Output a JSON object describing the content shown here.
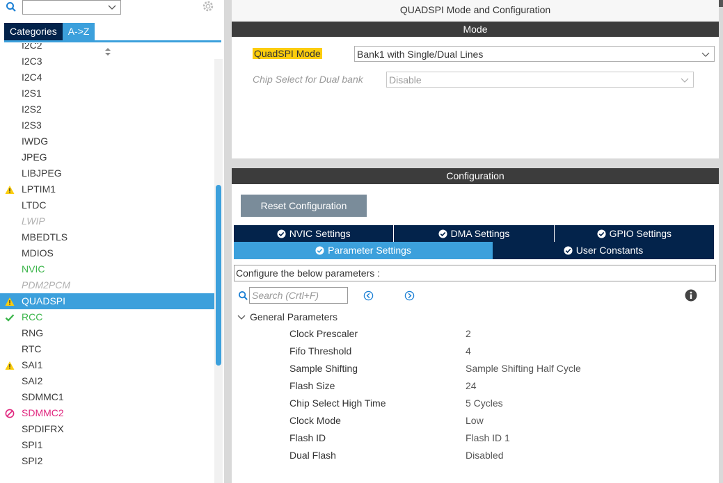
{
  "left": {
    "tabs": [
      {
        "label": "Categories"
      },
      {
        "label": "A->Z"
      }
    ],
    "items": [
      {
        "label": "I2C2",
        "state": "normal"
      },
      {
        "label": "I2C3",
        "state": "normal"
      },
      {
        "label": "I2C4",
        "state": "normal"
      },
      {
        "label": "I2S1",
        "state": "normal"
      },
      {
        "label": "I2S2",
        "state": "normal"
      },
      {
        "label": "I2S3",
        "state": "normal"
      },
      {
        "label": "IWDG",
        "state": "normal"
      },
      {
        "label": "JPEG",
        "state": "normal"
      },
      {
        "label": "LIBJPEG",
        "state": "normal"
      },
      {
        "label": "LPTIM1",
        "state": "warning"
      },
      {
        "label": "LTDC",
        "state": "normal"
      },
      {
        "label": "LWIP",
        "state": "disabled"
      },
      {
        "label": "MBEDTLS",
        "state": "normal"
      },
      {
        "label": "MDIOS",
        "state": "normal"
      },
      {
        "label": "NVIC",
        "state": "green"
      },
      {
        "label": "PDM2PCM",
        "state": "disabled"
      },
      {
        "label": "QUADSPI",
        "state": "warning-selected"
      },
      {
        "label": "RCC",
        "state": "check"
      },
      {
        "label": "RNG",
        "state": "normal"
      },
      {
        "label": "RTC",
        "state": "normal"
      },
      {
        "label": "SAI1",
        "state": "warning"
      },
      {
        "label": "SAI2",
        "state": "normal"
      },
      {
        "label": "SDMMC1",
        "state": "normal"
      },
      {
        "label": "SDMMC2",
        "state": "blocked"
      },
      {
        "label": "SPDIFRX",
        "state": "normal"
      },
      {
        "label": "SPI1",
        "state": "normal"
      },
      {
        "label": "SPI2",
        "state": "normal"
      }
    ]
  },
  "right": {
    "title": "QUADSPI Mode and Configuration",
    "mode_bar": "Mode",
    "quadspi_mode": {
      "label": "QuadSPI Mode",
      "value": "Bank1 with Single/Dual Lines"
    },
    "chip_select": {
      "label": "Chip Select for Dual bank",
      "value": "Disable"
    },
    "config_bar": "Configuration",
    "reset_button": "Reset Configuration",
    "tabs_row1": [
      {
        "label": "NVIC Settings"
      },
      {
        "label": "DMA Settings"
      },
      {
        "label": "GPIO Settings"
      }
    ],
    "tabs_row2": [
      {
        "label": "Parameter Settings"
      },
      {
        "label": "User Constants"
      }
    ],
    "configure_text": "Configure the below parameters :",
    "search_placeholder": "Search (Crtl+F)",
    "group_title": "General Parameters",
    "params": [
      {
        "name": "Clock Prescaler",
        "value": "2"
      },
      {
        "name": "Fifo Threshold",
        "value": "4"
      },
      {
        "name": "Sample Shifting",
        "value": "Sample Shifting Half Cycle"
      },
      {
        "name": "Flash Size",
        "value": "24"
      },
      {
        "name": "Chip Select High Time",
        "value": "5 Cycles"
      },
      {
        "name": "Clock Mode",
        "value": "Low"
      },
      {
        "name": "Flash ID",
        "value": "Flash ID 1"
      },
      {
        "name": "Dual Flash",
        "value": "Disabled"
      }
    ]
  },
  "colors": {
    "accent_blue": "#3ca0dc",
    "navy": "#03234b",
    "warning_yellow": "#fccd0d",
    "ok_green": "#3bb54a",
    "blocked_pink": "#e0267e",
    "bar_dark": "#3c3c3c"
  }
}
